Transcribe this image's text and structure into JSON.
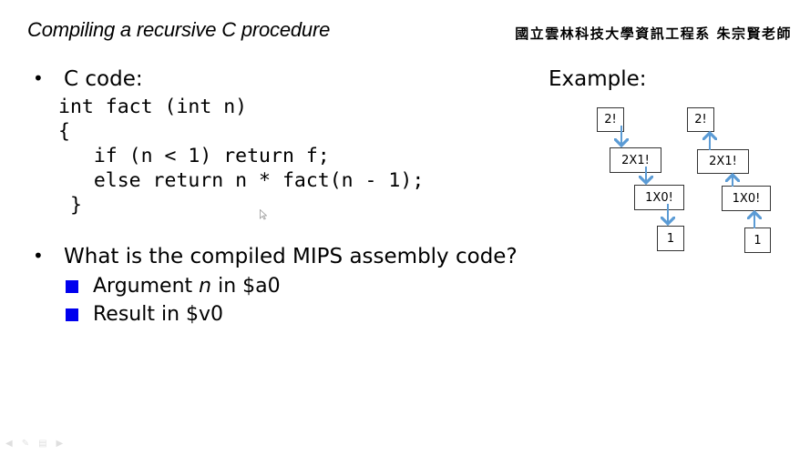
{
  "header": {
    "title": "Compiling a recursive C procedure",
    "affiliation": "國立雲林科技大學資訊工程系 朱宗賢老師"
  },
  "bullets": [
    {
      "marker": "•",
      "label": "C code:"
    },
    {
      "marker": "•",
      "label": "What is the compiled MIPS assembly code?"
    }
  ],
  "code_lines": [
    "int fact (int n)",
    "{",
    "   if (n < 1) return f;",
    "   else return n * fact(n - 1);",
    " }"
  ],
  "sub_bullets": [
    {
      "prefix": "Argument ",
      "italic": "n",
      "suffix": " in $a0"
    },
    {
      "prefix": "Result in $v0",
      "italic": "",
      "suffix": ""
    }
  ],
  "example": {
    "label": "Example:",
    "left_chain": [
      "2!",
      "2X1!",
      "1X0!",
      "1"
    ],
    "right_chain": [
      "2!",
      "2X1!",
      "1X0!",
      "1"
    ],
    "arrow_color": "#5b9bd5"
  },
  "colors": {
    "sub_bullet": "#0000ee"
  },
  "nav_icons": [
    "prev-icon",
    "pen-icon",
    "menu-icon",
    "next-icon"
  ]
}
